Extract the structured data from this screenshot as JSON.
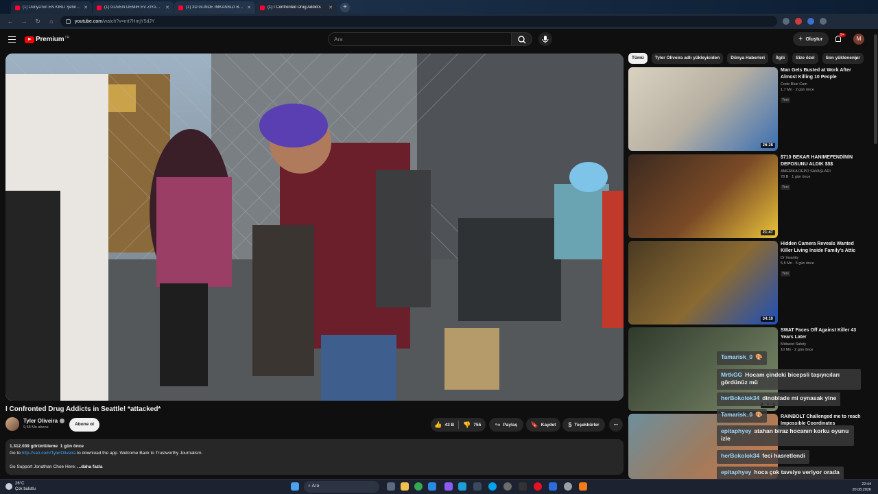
{
  "browser": {
    "tabs": [
      {
        "title": "(1) Dünya'nın EN KIRLI Şehrinde..."
      },
      {
        "title": "(1) GÜVEN DEMİR EV ZİYARETİ"
      },
      {
        "title": "(1) 3D GÜNDE İMKANSIZI BAŞARDIK"
      },
      {
        "title": "(1) I Confronted Drug Addicts"
      }
    ],
    "url_host": "youtube.com",
    "url_path": "/watch?v=mt7HmjY5dJY"
  },
  "header": {
    "logo_text": "Premium",
    "logo_sup": "TR",
    "search_placeholder": "Ara",
    "create_label": "Oluştur",
    "notif_count": "9+",
    "avatar_letter": "M"
  },
  "video": {
    "title": "I Confronted Drug Addicts in Seattle! *attacked*",
    "channel": "Tyler Oliveira",
    "subscribers": "9,58 Mn abone",
    "subscribe_label": "Abone ol",
    "likes": "43 B",
    "dislikes": "755",
    "share_label": "Paylaş",
    "save_label": "Kaydet",
    "thanks_label": "Teşekkürler",
    "more_label": "⋯",
    "views": "1.312.039 görüntüleme",
    "age": "1 gün önce",
    "desc_prefix": "Go to ",
    "desc_link": "http://san.com/TylerOliveira",
    "desc_suffix": " to download the app. Welcome Back to Trustworthy Journalism.",
    "desc_line2": "Go Support Jonathan Choe Here: ",
    "more_text": "...daha fazla"
  },
  "chips": [
    "Tümü",
    "Tyler Oliveira adlı yükleyiciden",
    "Dünya Haberleri",
    "İlgili",
    "Size özel",
    "Son yüklenenler"
  ],
  "recommendations": [
    {
      "title": "Man Gets Busted at Work After Almost Killing 10 People",
      "channel": "Code Blue Cam",
      "meta": "1,7 Mn · 2 gün önce",
      "badge": "Yeni",
      "duration": "26:28",
      "colors": [
        "#d9d2c1",
        "#3a6fb3"
      ]
    },
    {
      "title": "$710 BEKAR HANIMEFENDİNİN DEPOSUNU ALDIK $$$",
      "channel": "AMERİKA DEPO SAVAŞLARI",
      "meta": "78 B · 1 gün önce",
      "badge": "Yeni",
      "duration": "21:47",
      "colors": [
        "#3b2a20",
        "#e8c23a"
      ]
    },
    {
      "title": "Hidden Camera Reveals Wanted Killer Living Inside Family's Attic",
      "channel": "Dr Insanity",
      "meta": "5,5 Mn · 5 gün önce",
      "badge": "Yeni",
      "duration": "34:10",
      "colors": [
        "#4a3a22",
        "#1f4fb8"
      ]
    },
    {
      "title": "SWAT Faces Off Against Killer 43 Years Later",
      "channel": "Midwest Safety",
      "meta": "10 Mn · 2 gün önce",
      "badge": "",
      "duration": "45:43",
      "colors": [
        "#2f3a2b",
        "#7b8a6a"
      ]
    },
    {
      "title": "RAINBOLT Challenged me to reach Impossible Coordinates",
      "channel": "",
      "meta": "3,5 Mn · 10 gün önce",
      "badge": "",
      "duration": "",
      "colors": [
        "#6d8f9d",
        "#d07a4b"
      ]
    }
  ],
  "chat": [
    {
      "user": "Tamarisk_0",
      "text": "🎨"
    },
    {
      "user": "MrtkGG",
      "text": "Hocam çindeki bicepsli taşıyıcıları gördünüz mü"
    },
    {
      "user": "herBokolok34",
      "text": "dinoblade mi oynasak yine"
    },
    {
      "user": "Tamarisk_0",
      "text": "🎨"
    },
    {
      "user": "epitaphyey",
      "text": "atahan biraz hocanın korku oyunu izle"
    },
    {
      "user": "herBokolok34",
      "text": "feci hasretlendi"
    },
    {
      "user": "epitaphyey",
      "text": "hoca çok tavsiye veriyor orada"
    }
  ],
  "taskbar": {
    "temp": "26°C",
    "weather": "Çok bulutlu",
    "search_placeholder": "Ara",
    "time": "22:44",
    "date": "20.08.2026"
  }
}
